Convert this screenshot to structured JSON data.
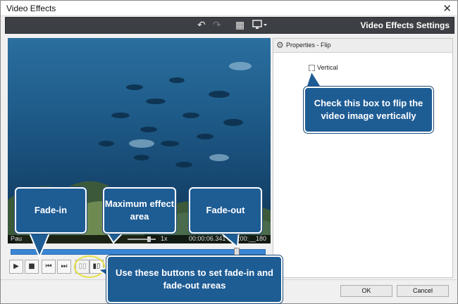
{
  "window": {
    "title": "Video Effects",
    "close_glyph": "✕"
  },
  "toolbar": {
    "title": "Video Effects Settings",
    "icons": {
      "undo": "↶",
      "redo": "↷",
      "grid": "▦",
      "monitor": "▭"
    }
  },
  "player": {
    "status": "Pau",
    "speed": "1x",
    "time": "00:00:06.341 / 00:00:__180"
  },
  "playback": {
    "play": "▶",
    "stop": "■",
    "prev": "⏮",
    "next": "⏭",
    "fade_in_glyph": "▯▯",
    "fade_out_glyph": "▮▯"
  },
  "properties": {
    "header": "Properties - Flip",
    "vertical_label": "Vertical",
    "vertical_checked": false
  },
  "footer": {
    "ok": "OK",
    "cancel": "Cancel"
  },
  "callouts": {
    "flip": "Check this box to flip the video image vertically",
    "fade_in": "Fade-in",
    "max_area": "Maximum effect area",
    "fade_out": "Fade-out",
    "buttons": "Use these buttons to set fade-in and fade-out areas"
  },
  "colors": {
    "callout_bg": "#1e5c94",
    "timeline": "#3a86d4",
    "highlight": "#e6e14a",
    "toolbar_bg": "#3c3f43"
  }
}
